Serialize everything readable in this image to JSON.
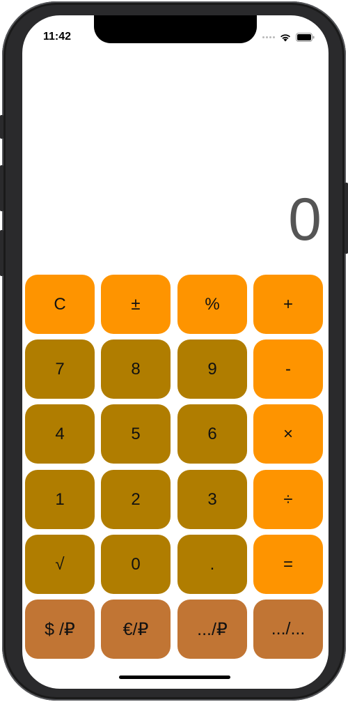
{
  "status_bar": {
    "time": "11:42",
    "icons": [
      "cellular-signal-icon",
      "wifi-icon",
      "battery-icon"
    ]
  },
  "display": {
    "value": "0"
  },
  "keys": {
    "clear": "C",
    "sign": "±",
    "percent": "%",
    "plus": "+",
    "seven": "7",
    "eight": "8",
    "nine": "9",
    "minus": "-",
    "four": "4",
    "five": "5",
    "six": "6",
    "multiply": "×",
    "one": "1",
    "two": "2",
    "three": "3",
    "divide": "÷",
    "sqrt": "√",
    "zero": "0",
    "dot": ".",
    "equals": "=",
    "usd_rub": "$ /₽",
    "eur_rub": "€/₽",
    "any_rub": ".../₽",
    "any_any": ".../..."
  },
  "colors": {
    "operator": "#FE9400",
    "digit": "#B07D00",
    "currency": "#C17534",
    "display_text": "#555555"
  }
}
